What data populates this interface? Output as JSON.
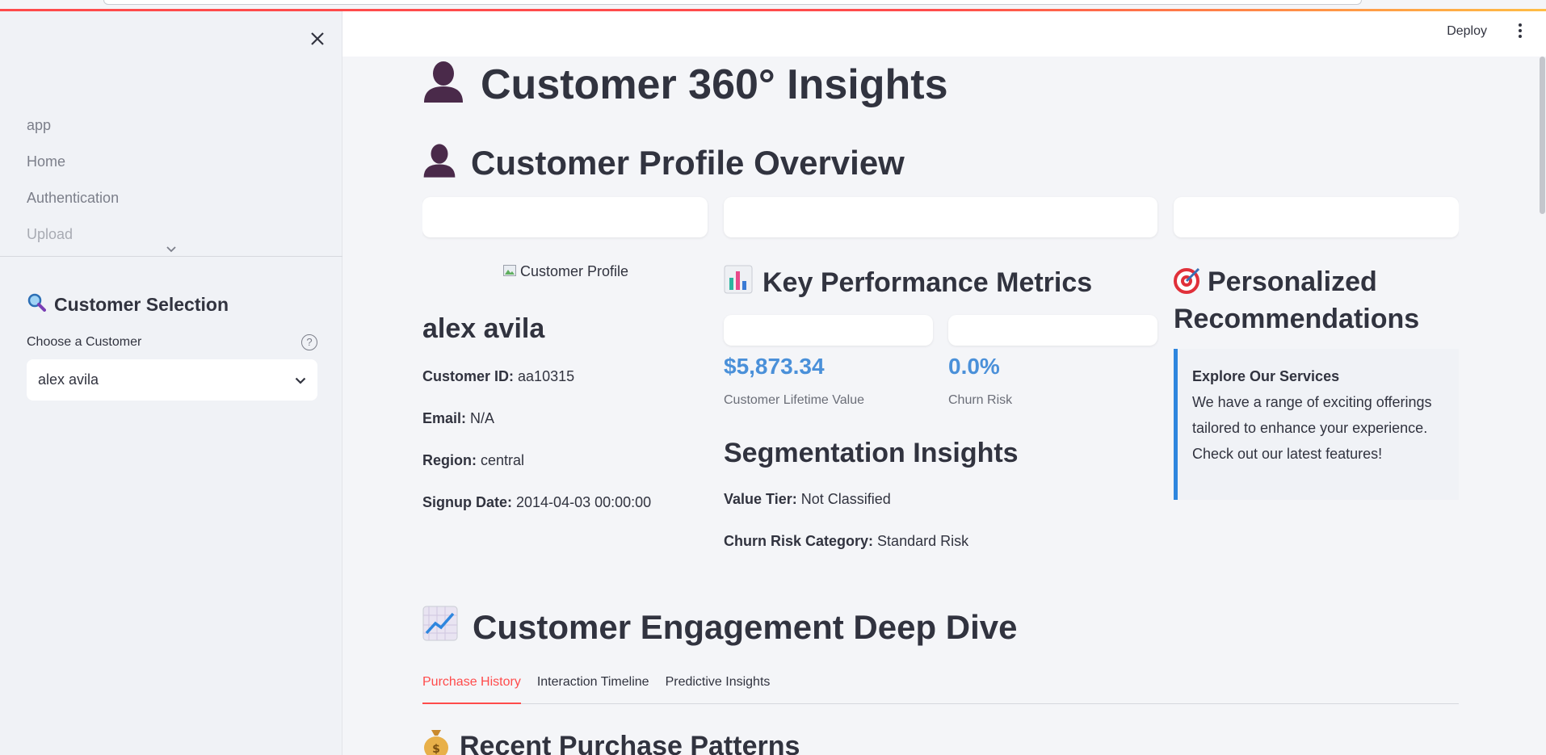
{
  "sidebar": {
    "nav_items": [
      "app",
      "Home",
      "Authentication",
      "Upload"
    ],
    "section_title": "Customer Selection",
    "select_label": "Choose a Customer",
    "select_value": "alex avila"
  },
  "header": {
    "deploy_label": "Deploy"
  },
  "main": {
    "page_title": "Customer 360° Insights",
    "profile_title": "Customer Profile Overview",
    "image_alt": "Customer Profile",
    "customer_name": "alex avila",
    "fields": {
      "customer_id_label": "Customer ID:",
      "customer_id": "aa10315",
      "email_label": "Email:",
      "email": "N/A",
      "region_label": "Region:",
      "region": "central",
      "signup_label": "Signup Date:",
      "signup": "2014-04-03 00:00:00"
    },
    "kpi_title": "Key Performance Metrics",
    "clv_value": "$5,873.34",
    "clv_label": "Customer Lifetime Value",
    "churn_value": "0.0%",
    "churn_label": "Churn Risk",
    "segmentation_title": "Segmentation Insights",
    "value_tier_label": "Value Tier:",
    "value_tier": "Not Classified",
    "churn_cat_label": "Churn Risk Category:",
    "churn_cat": "Standard Risk",
    "rec_title": "Personalized Recommendations",
    "rec_box_title": "Explore Our Services",
    "rec_box_text": "We have a range of exciting offerings tailored to enhance your experience. Check out our latest features!",
    "engagement_title": "Customer Engagement Deep Dive",
    "tabs": [
      "Purchase History",
      "Interaction Timeline",
      "Predictive Insights"
    ],
    "purchase_title": "Recent Purchase Patterns"
  },
  "colors": {
    "accent": "#ff4b4b",
    "metric": "#4a90d9",
    "rec_border": "#2e86de"
  },
  "icons": [
    "close-icon",
    "chevron-down-icon",
    "search-icon",
    "help-icon",
    "kebab-icon",
    "person-icon",
    "bar-chart-icon",
    "target-icon",
    "trend-chart-icon",
    "money-bag-icon"
  ]
}
